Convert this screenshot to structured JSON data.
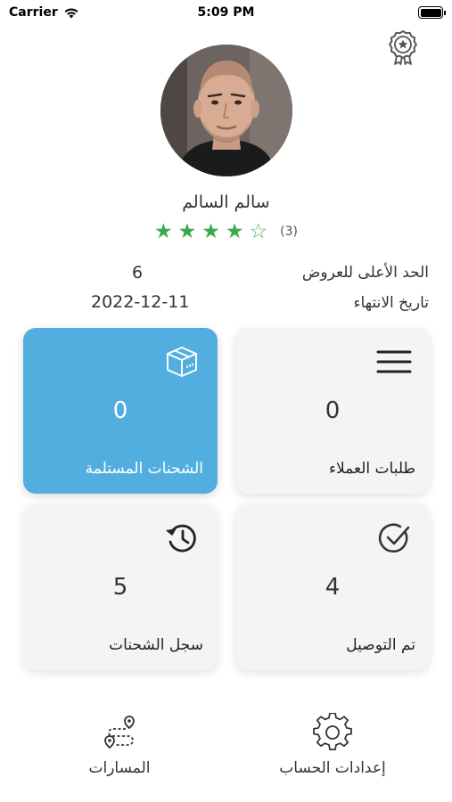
{
  "status_bar": {
    "carrier": "Carrier",
    "time": "5:09 PM"
  },
  "profile": {
    "name": "سالم السالم",
    "rating": {
      "filled_stars": 4,
      "total_stars": 5,
      "count_text": "(3)"
    }
  },
  "info": {
    "max_offers_label": "الحد الأعلى للعروض",
    "max_offers_value": "6",
    "expiry_label": "تاريخ الانتهاء",
    "expiry_value": "2022-12-11"
  },
  "cards": [
    {
      "label": "الشحنات المستلمة",
      "count": "0",
      "icon": "package-icon",
      "active": true
    },
    {
      "label": "طلبات العملاء",
      "count": "0",
      "icon": "menu-icon",
      "active": false
    },
    {
      "label": "سجل الشحنات",
      "count": "5",
      "icon": "history-icon",
      "active": false
    },
    {
      "label": "تم التوصيل",
      "count": "4",
      "icon": "check-circle-icon",
      "active": false
    }
  ],
  "bottom_nav": {
    "routes_label": "المسارات",
    "routes_icon": "route-icon",
    "settings_label": "إعدادات الحساب",
    "settings_icon": "gear-icon"
  },
  "colors": {
    "accent": "#53aee0",
    "star": "#3aaa4d",
    "card_bg": "#f4f4f4"
  }
}
